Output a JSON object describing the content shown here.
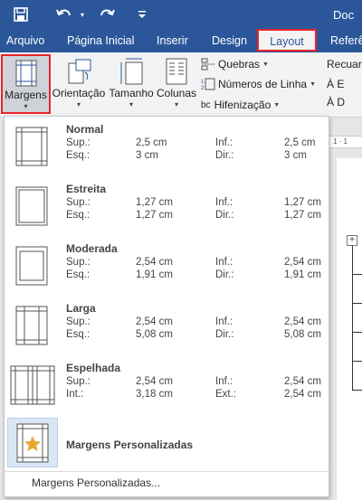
{
  "title_bar": {
    "doc_title": "Doc",
    "icons": [
      "save-icon",
      "undo-icon",
      "redo-icon",
      "customize-dropdown-icon"
    ],
    "color": "#2b579a"
  },
  "tabs": [
    {
      "label": "Arquivo"
    },
    {
      "label": "Página Inicial"
    },
    {
      "label": "Inserir"
    },
    {
      "label": "Design"
    },
    {
      "label": "Layout",
      "active": true
    },
    {
      "label": "Referê"
    }
  ],
  "ribbon": {
    "margens": "Margens",
    "orientacao": "Orientação",
    "tamanho": "Tamanho",
    "colunas": "Colunas",
    "quebras": "Quebras",
    "numeros_linha": "Números de Linha",
    "hifenizacao": "Hifenização",
    "hifen_prefix": "bc",
    "recuar": "Recuar",
    "recuar_item_1": "À E",
    "recuar_item_2": "À D"
  },
  "ruler_text": "1 · 1",
  "margins_menu": {
    "options": [
      {
        "name": "Normal",
        "label_a": "Sup.:",
        "value_a": "2,5 cm",
        "label_b": "Inf.:",
        "value_b": "2,5 cm",
        "label_c": "Esq.:",
        "value_c": "3 cm",
        "label_d": "Dir.:",
        "value_d": "3 cm"
      },
      {
        "name": "Estreita",
        "label_a": "Sup.:",
        "value_a": "1,27 cm",
        "label_b": "Inf.:",
        "value_b": "1,27 cm",
        "label_c": "Esq.:",
        "value_c": "1,27 cm",
        "label_d": "Dir.:",
        "value_d": "1,27 cm"
      },
      {
        "name": "Moderada",
        "label_a": "Sup.:",
        "value_a": "2,54 cm",
        "label_b": "Inf.:",
        "value_b": "2,54 cm",
        "label_c": "Esq.:",
        "value_c": "1,91 cm",
        "label_d": "Dir.:",
        "value_d": "1,91 cm"
      },
      {
        "name": "Larga",
        "label_a": "Sup.:",
        "value_a": "2,54 cm",
        "label_b": "Inf.:",
        "value_b": "2,54 cm",
        "label_c": "Esq.:",
        "value_c": "5,08 cm",
        "label_d": "Dir.:",
        "value_d": "5,08 cm"
      },
      {
        "name": "Espelhada",
        "label_a": "Sup.:",
        "value_a": "2,54 cm",
        "label_b": "Inf.:",
        "value_b": "2,54 cm",
        "label_c": "Int.:",
        "value_c": "3,18 cm",
        "label_d": "Ext.:",
        "value_d": "2,54 cm"
      }
    ],
    "custom_last": "Margens Personalizadas",
    "footer": "Margens Personalizadas..."
  },
  "colors": {
    "highlight_border": "#e8232b",
    "accent": "#2b579a",
    "custom_bg": "#dce7f5",
    "star": "#e8a838"
  }
}
